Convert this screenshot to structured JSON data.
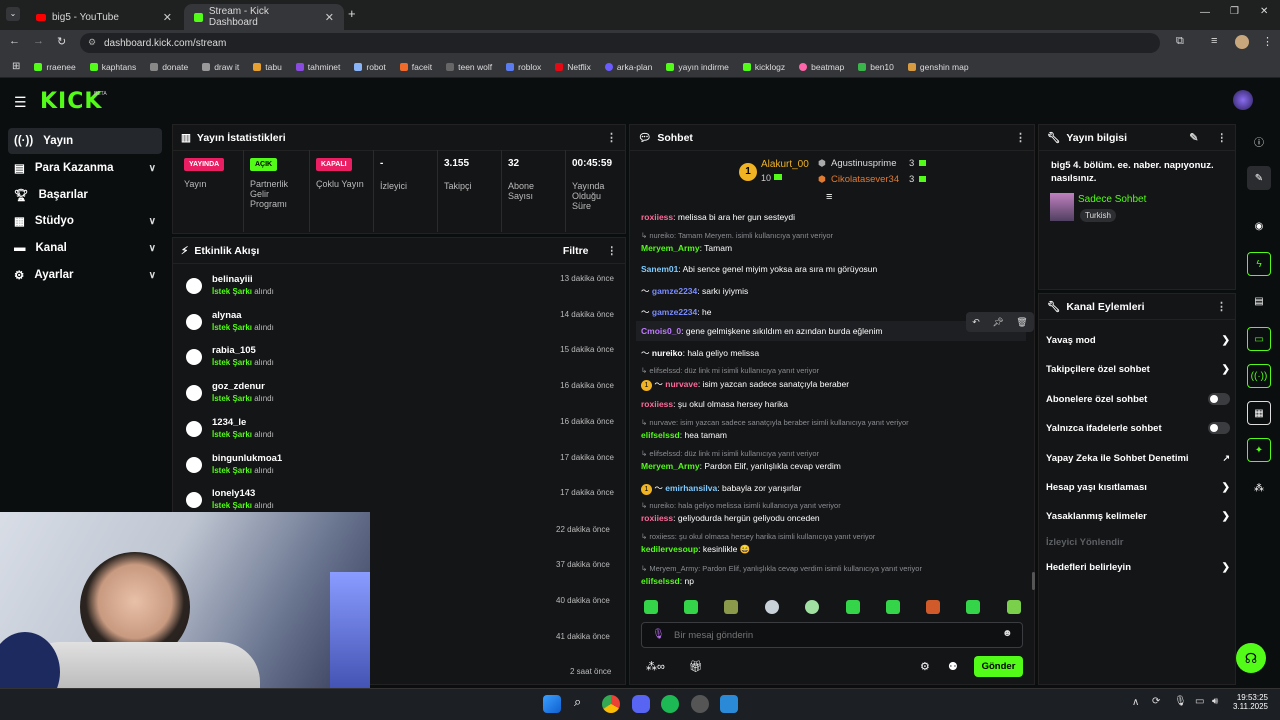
{
  "browser": {
    "tabs": [
      {
        "title": "big5 - YouTube"
      },
      {
        "title": "Stream - Kick Dashboard"
      }
    ],
    "url": "dashboard.kick.com/stream",
    "bookmarks": [
      "rraenee",
      "kaphtans",
      "donate",
      "draw it",
      "tabu",
      "tahminet",
      "robot",
      "faceit",
      "teen wolf",
      "roblox",
      "Netflix",
      "arka-plan",
      "yayın indirme",
      "kicklogz",
      "beatmap",
      "ben10",
      "genshin map"
    ]
  },
  "logo": {
    "text": "KICK",
    "beta": "BETA"
  },
  "sidebar": {
    "items": [
      {
        "label": "Yayın"
      },
      {
        "label": "Para Kazanma"
      },
      {
        "label": "Başarılar"
      },
      {
        "label": "Stüdyo"
      },
      {
        "label": "Kanal"
      },
      {
        "label": "Ayarlar"
      }
    ]
  },
  "stats": {
    "title": "Yayın İstatistikleri",
    "cols": [
      {
        "badge": "YAYINDA",
        "label": "Yayın"
      },
      {
        "badge": "AÇIK",
        "label": "Partnerlik Gelir Programı"
      },
      {
        "badge": "KAPALI",
        "label": "Çoklu Yayın"
      },
      {
        "value": "-",
        "label": "İzleyici"
      },
      {
        "value": "3.155",
        "label": "Takipçi"
      },
      {
        "value": "32",
        "label": "Abone Sayısı"
      },
      {
        "value": "00:45:59",
        "label": "Yayında Olduğu Süre"
      }
    ]
  },
  "activity": {
    "title": "Etkinlik Akışı",
    "filter": "Filtre",
    "events": [
      {
        "name": "belinayiii",
        "kind": "İstek Şarkı",
        "suffix": "alındı",
        "time": "13 dakika önce"
      },
      {
        "name": "alynaa",
        "kind": "İstek Şarkı",
        "suffix": "alındı",
        "time": "14 dakika önce"
      },
      {
        "name": "rabia_105",
        "kind": "İstek Şarkı",
        "suffix": "alındı",
        "time": "15 dakika önce"
      },
      {
        "name": "goz_zdenur",
        "kind": "İstek Şarkı",
        "suffix": "alındı",
        "time": "16 dakika önce"
      },
      {
        "name": "1234_le",
        "kind": "İstek Şarkı",
        "suffix": "alındı",
        "time": "16 dakika önce"
      },
      {
        "name": "bingunlukmoa1",
        "kind": "İstek Şarkı",
        "suffix": "alındı",
        "time": "17 dakika önce"
      },
      {
        "name": "lonely143",
        "kind": "İstek Şarkı",
        "suffix": "alındı",
        "time": "17 dakika önce"
      }
    ],
    "hidden_times": [
      "22 dakika önce",
      "37 dakika önce",
      "40 dakika önce",
      "41 dakika önce",
      "2 saat önce"
    ]
  },
  "chat": {
    "title": "Sohbet",
    "top_gifters": [
      {
        "name": "Alakurt_00",
        "count": "10"
      },
      {
        "name": "Agustinusprime",
        "count": "3"
      },
      {
        "name": "Cikolatasever34",
        "count": "3"
      }
    ],
    "messages": [
      {
        "user": "roxiiess",
        "text": "melissa bi ara her gun sesteydi",
        "color": "#ff6a9a"
      },
      {
        "reply": "nureiko: Tamam Meryem. isimli kullanıcıya yanıt veriyor"
      },
      {
        "user": "Meryem_Army",
        "text": "Tamam",
        "color": "#53fc18"
      },
      {
        "user": "Sanem01",
        "text": "Abi sence genel miyim yoksa ara sıra mı görüyosun",
        "color": "#7ecbff"
      },
      {
        "user": "gamze2234",
        "text": "sarkı iyiymis",
        "color": "#7a8cff"
      },
      {
        "user": "gamze2234",
        "text": "he",
        "color": "#7a8cff"
      },
      {
        "user": "Cmois0_0",
        "text": "gene gelmişkene sıkıldım en azından burda eğlenim",
        "color": "#c07aff"
      },
      {
        "user": "nureiko",
        "text": "hala geliyo melissa",
        "color": "#ffffff"
      },
      {
        "reply": "elifselssd: düz link mi isimli kullanıcıya yanıt veriyor"
      },
      {
        "user": "nurvave",
        "text": "isim yazcan sadece sanatçıyla beraber",
        "color": "#ff6a9a"
      },
      {
        "user": "roxiiess",
        "text": "şu okul olmasa hersey harika",
        "color": "#ff6a9a"
      },
      {
        "reply": "nurvave: isim yazcan sadece sanatçıyla beraber isimli kullanıcıya yanıt veriyor"
      },
      {
        "user": "elifselssd",
        "text": "hea tamam",
        "color": "#53fc18"
      },
      {
        "reply": "elifselssd: düz link mi isimli kullanıcıya yanıt veriyor"
      },
      {
        "user": "Meryem_Army",
        "text": "Pardon Elif, yanlışlıkla cevap verdim",
        "color": "#53fc18"
      },
      {
        "user": "emirhansilva",
        "text": "babayla zor yarışırlar",
        "color": "#7ecbff"
      },
      {
        "reply": "nureiko: hala geliyo melissa isimli kullanıcıya yanıt veriyor"
      },
      {
        "user": "roxiiess",
        "text": "geliyodurda hergün geliyodu onceden",
        "color": "#ff6a9a"
      },
      {
        "reply": "roxiiess: şu okul olmasa hersey harika isimli kullanıcıya yanıt veriyor"
      },
      {
        "user": "kedilervesoup",
        "text": "kesinlikle 😄",
        "color": "#53fc18"
      },
      {
        "reply": "Meryem_Army: Pardon Elif, yanlışlıkla cevap verdim isimli kullanıcıya yanıt veriyor"
      },
      {
        "user": "elifselssd",
        "text": "np",
        "color": "#53fc18"
      }
    ],
    "input_placeholder": "Bir mesaj gönderin",
    "send_label": "Gönder"
  },
  "stream_info": {
    "title": "Yayın bilgisi",
    "stream_title": "big5 4. bölüm. ee. naber. napıyonuz. nasılsınız.",
    "category": "Sadece Sohbet",
    "language": "Turkish"
  },
  "channel_actions": {
    "title": "Kanal Eylemleri",
    "items": [
      {
        "label": "Yavaş mod",
        "type": "arrow"
      },
      {
        "label": "Takipçilere özel sohbet",
        "type": "arrow"
      },
      {
        "label": "Abonelere özel sohbet",
        "type": "toggle"
      },
      {
        "label": "Yalnızca ifadelerle sohbet",
        "type": "toggle"
      },
      {
        "label": "Yapay Zeka ile Sohbet Denetimi",
        "type": "link"
      },
      {
        "label": "Hesap yaşı kısıtlaması",
        "type": "arrow"
      },
      {
        "label": "Yasaklanmış kelimeler",
        "type": "arrow"
      },
      {
        "label": "İzleyici Yönlendir",
        "type": "disabled"
      },
      {
        "label": "Hedefleri belirleyin",
        "type": "arrow"
      }
    ]
  },
  "taskbar": {
    "time": "19:53:25",
    "date": "3.11.2025"
  },
  "colors": {
    "accent": "#53fc18",
    "live": "#e91e63",
    "bg": "#0b0e0f",
    "panel": "#141517"
  }
}
